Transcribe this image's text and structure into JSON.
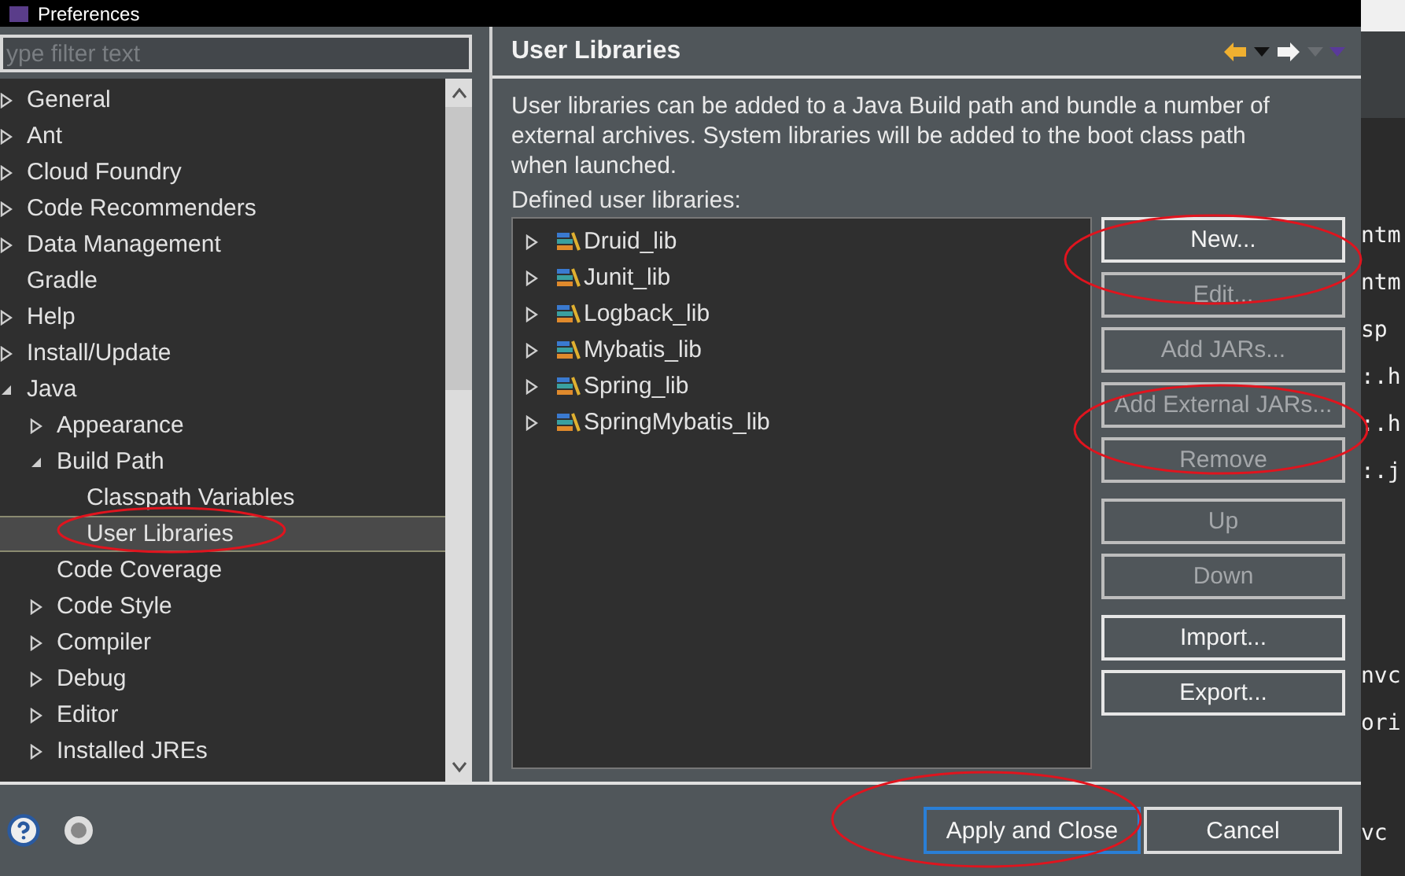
{
  "window": {
    "title": "Preferences"
  },
  "filter": {
    "placeholder": "ype filter text"
  },
  "tree": [
    {
      "label": "General",
      "expanded": false,
      "selected": false
    },
    {
      "label": "Ant",
      "expanded": false,
      "selected": false
    },
    {
      "label": "Cloud Foundry",
      "expanded": false,
      "selected": false
    },
    {
      "label": "Code Recommenders",
      "expanded": false,
      "selected": false
    },
    {
      "label": "Data Management",
      "expanded": false,
      "selected": false
    },
    {
      "label": "Gradle",
      "selected": false
    },
    {
      "label": "Help",
      "expanded": false,
      "selected": false
    },
    {
      "label": "Install/Update",
      "expanded": false,
      "selected": false
    },
    {
      "label": "Java",
      "expanded": true,
      "selected": false,
      "children": [
        {
          "label": "Appearance",
          "expanded": false,
          "selected": false
        },
        {
          "label": "Build Path",
          "expanded": true,
          "selected": false,
          "children": [
            {
              "label": "Classpath Variables",
              "selected": false
            },
            {
              "label": "User Libraries",
              "selected": true
            }
          ]
        },
        {
          "label": "Code Coverage",
          "selected": false
        },
        {
          "label": "Code Style",
          "expanded": false,
          "selected": false
        },
        {
          "label": "Compiler",
          "expanded": false,
          "selected": false
        },
        {
          "label": "Debug",
          "expanded": false,
          "selected": false
        },
        {
          "label": "Editor",
          "expanded": false,
          "selected": false
        },
        {
          "label": "Installed JREs",
          "expanded": false,
          "selected": false
        }
      ]
    }
  ],
  "page": {
    "title": "User Libraries",
    "description": "User libraries can be added to a Java Build path and bundle a number of external archives. System libraries will be added to the boot class path when launched.",
    "list_label": "Defined user libraries:",
    "libraries": [
      {
        "label": "Druid_lib",
        "expanded": false
      },
      {
        "label": "Junit_lib",
        "expanded": false
      },
      {
        "label": "Logback_lib",
        "expanded": false
      },
      {
        "label": "Mybatis_lib",
        "expanded": false
      },
      {
        "label": "Spring_lib",
        "expanded": false
      },
      {
        "label": "SpringMybatis_lib",
        "expanded": false
      }
    ],
    "button_groups": [
      [
        {
          "label": "New...",
          "disabled": false
        },
        {
          "label": "Edit...",
          "disabled": true
        },
        {
          "label": "Add JARs...",
          "disabled": true
        },
        {
          "label": "Add External JARs...",
          "disabled": true
        },
        {
          "label": "Remove",
          "disabled": true
        }
      ],
      [
        {
          "label": "Up",
          "disabled": true
        },
        {
          "label": "Down",
          "disabled": true
        }
      ],
      [
        {
          "label": "Import...",
          "disabled": false
        },
        {
          "label": "Export...",
          "disabled": false
        }
      ]
    ]
  },
  "footer": {
    "buttons": [
      {
        "label": "Apply and Close",
        "default": true
      },
      {
        "label": "Cancel",
        "default": false
      }
    ]
  },
  "editor": {
    "line_groups": [
      [
        "ntm",
        "ntm",
        "sp",
        ":.h",
        ":.h",
        ":.j"
      ],
      [
        "nvc",
        "ori"
      ],
      [
        "vc"
      ]
    ]
  }
}
